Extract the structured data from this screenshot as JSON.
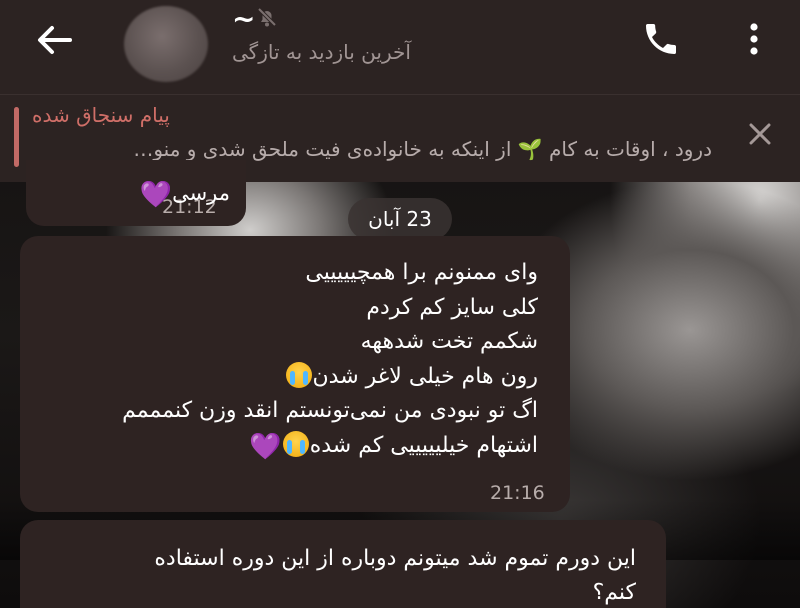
{
  "header": {
    "contact_name": "~",
    "last_seen": "آخرین بازدید به تازگی",
    "icons": {
      "back": "arrow-left-icon",
      "mute": "muted-bell-icon",
      "call": "phone-icon",
      "menu": "more-vertical-icon",
      "avatar": "avatar"
    }
  },
  "pinned": {
    "title": "پیام سنجاق شده",
    "text_before": "درود ، اوقات به کام ",
    "sprout": "🌱",
    "text_after": " از اینکه به خانواده‌ی فیت ملحق شدی و منو…",
    "close_icon": "close-icon",
    "accent_color": "#d06f68"
  },
  "messages": [
    {
      "text": "مرسی",
      "emoji": "💜",
      "time": "21:12"
    },
    {
      "date_separator": "23 آبان"
    },
    {
      "lines": [
        "وای ممنونم برا همچیییییی",
        "کلی سایز کم کردم",
        "شکمم تخت شدههه",
        "رون هام خیلی لاغر شدن",
        "اگ تو نبودی من نمی‌تونستم انقد وزن کنمممم",
        "اشتهام خیلیییییی کم شده"
      ],
      "time": "21:16"
    },
    {
      "lines": [
        "این دورم تموم شد میتونم دوباره از این دوره استفاده",
        "کنم؟"
      ]
    }
  ],
  "colors": {
    "header_bg": "#2c2322",
    "bubble_bg": "#2e2322",
    "time_color": "#b8adab"
  }
}
